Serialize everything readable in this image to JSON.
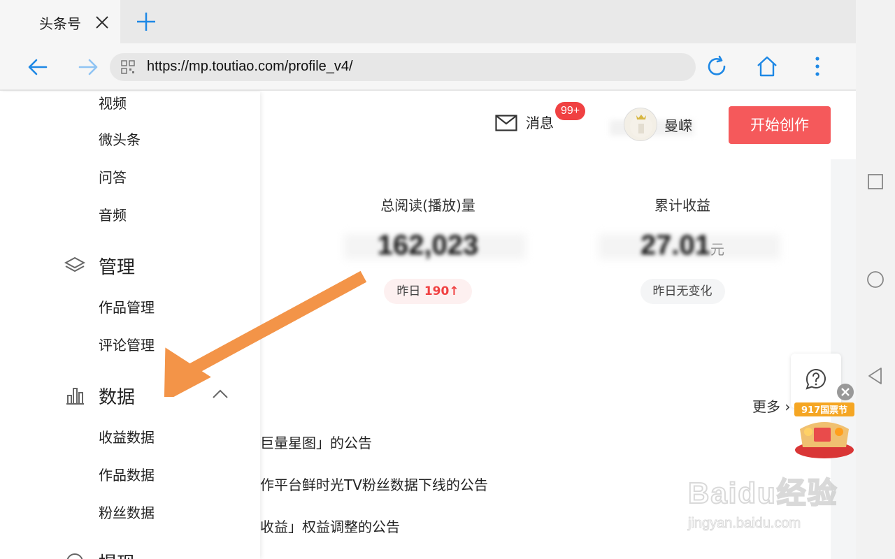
{
  "browser": {
    "tab_title": "头条号",
    "url": "https://mp.toutiao.com/profile_v4/"
  },
  "header": {
    "messages_label": "消息",
    "messages_badge": "99+",
    "username": "曼嵘",
    "create_button": "开始创作"
  },
  "sidebar": {
    "top_items": [
      "视频",
      "微头条",
      "问答",
      "音频"
    ],
    "manage": {
      "title": "管理",
      "items": [
        "作品管理",
        "评论管理"
      ]
    },
    "data": {
      "title": "数据",
      "items": [
        "收益数据",
        "作品数据",
        "粉丝数据"
      ]
    },
    "next_section": "提现"
  },
  "stats": [
    {
      "label": "总阅读(播放)量",
      "value": "162,023",
      "unit": "",
      "change_prefix": "昨日",
      "change_value": "190",
      "change_arrow": "↑",
      "change_color": "#f04142"
    },
    {
      "label": "累计收益",
      "value": "27.01",
      "unit": "元",
      "change_prefix": "昨日无变化",
      "change_value": "",
      "change_arrow": "",
      "change_color": "#444444"
    }
  ],
  "notices": {
    "more_label": "更多",
    "items": [
      "巨量星图」的公告",
      "作平台鲜时光TV粉丝数据下线的公告",
      "收益」权益调整的公告"
    ]
  },
  "promo": {
    "label": "917国票节"
  },
  "watermark": {
    "brand": "Baidu经验",
    "sub": "jingyan.baidu.com"
  },
  "colors": {
    "accent": "#f5595b",
    "badge": "#f04142",
    "arrow": "#f39448",
    "link_blue": "#1e88e5"
  }
}
